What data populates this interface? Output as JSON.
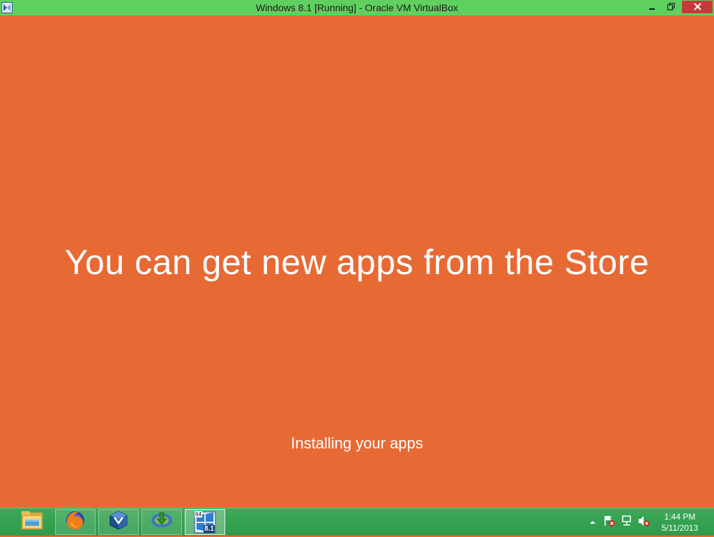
{
  "window": {
    "title": "Windows 8.1 [Running] - Oracle VM VirtualBox",
    "minimize_icon": "minimize-icon",
    "restore_icon": "restore-icon",
    "close_icon": "close-icon"
  },
  "screen": {
    "headline": "You can get new apps from the Store",
    "status": "Installing your apps",
    "background_color": "#e76a35"
  },
  "taskbar": {
    "apps": [
      {
        "name": "file-explorer",
        "icon": "folder-icon"
      },
      {
        "name": "firefox",
        "icon": "firefox-icon"
      },
      {
        "name": "virtualbox",
        "icon": "virtualbox-icon"
      },
      {
        "name": "internet-download-manager",
        "icon": "download-manager-icon"
      },
      {
        "name": "windows-8.1-vm",
        "icon": "windows-vm-icon",
        "badge_top": "64",
        "badge_bottom": "8.1"
      }
    ],
    "tray": {
      "show_hidden_icon": "chevron-up-icon",
      "action_center_icon": "flag-icon",
      "network_icon": "network-icon",
      "volume_icon": "speaker-muted-icon",
      "time": "1:44 PM",
      "date": "5/11/2013"
    },
    "color": "#36a352"
  }
}
